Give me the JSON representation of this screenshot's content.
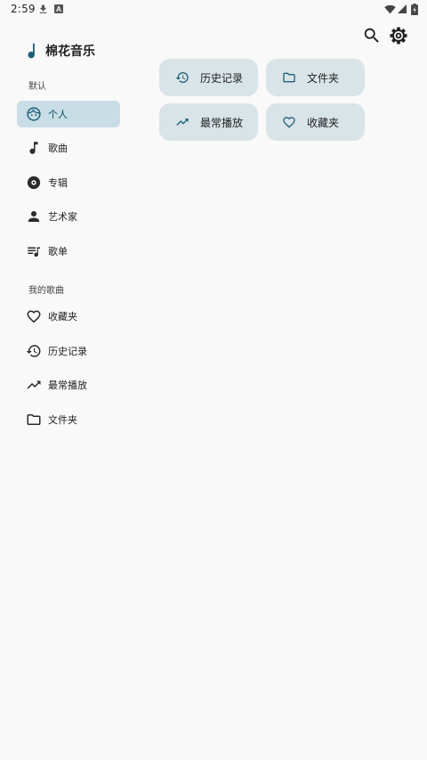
{
  "status_bar": {
    "time": "2:59",
    "icons": [
      "download-icon",
      "font-icon",
      "wifi-icon",
      "signal-icon",
      "battery-icon"
    ]
  },
  "app": {
    "title": "棉花音乐",
    "logo_icon": "music-note-icon",
    "accent_color": "#1f5f78"
  },
  "toolbar": {
    "actions": [
      "search-icon",
      "gear-icon"
    ]
  },
  "sidebar": {
    "section_default": "默认",
    "section_mine": "我的歌曲",
    "default_items": [
      {
        "label": "个人",
        "icon": "face-icon",
        "selected": true
      },
      {
        "label": "歌曲",
        "icon": "music-note-icon",
        "selected": false
      },
      {
        "label": "专辑",
        "icon": "album-icon",
        "selected": false
      },
      {
        "label": "艺术家",
        "icon": "person-icon",
        "selected": false
      },
      {
        "label": "歌单",
        "icon": "playlist-icon",
        "selected": false
      }
    ],
    "mine_items": [
      {
        "label": "收藏夹",
        "icon": "heart-icon"
      },
      {
        "label": "历史记录",
        "icon": "history-icon"
      },
      {
        "label": "最常播放",
        "icon": "trending-up-icon"
      },
      {
        "label": "文件夹",
        "icon": "folder-icon"
      }
    ],
    "selected_background": "#c8dde6"
  },
  "quick_access": [
    {
      "label": "历史记录",
      "icon": "history-icon"
    },
    {
      "label": "文件夹",
      "icon": "folder-icon"
    },
    {
      "label": "最常播放",
      "icon": "trending-up-icon"
    },
    {
      "label": "收藏夹",
      "icon": "heart-icon"
    }
  ],
  "quick_card_background": "#d9e4e8"
}
